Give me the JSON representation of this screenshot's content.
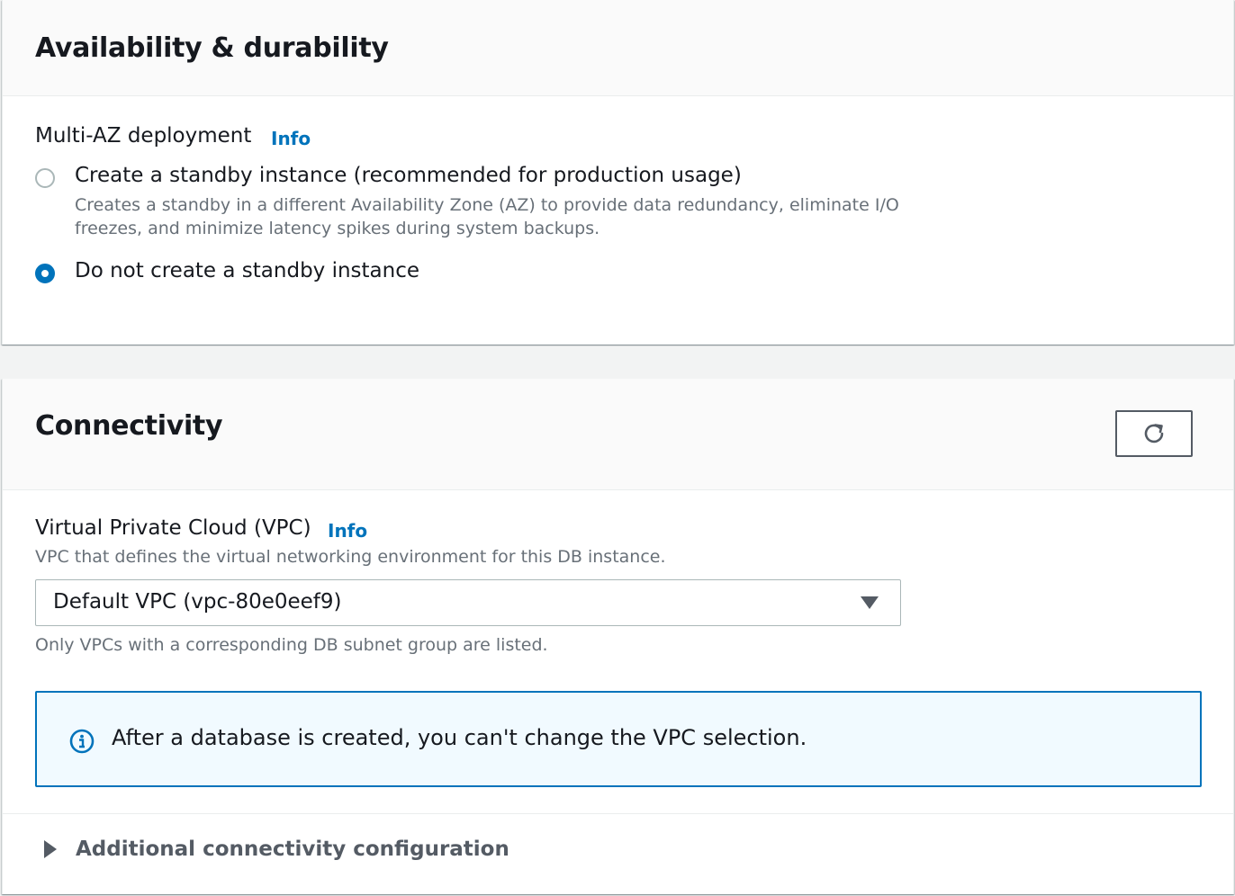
{
  "availability": {
    "title": "Availability & durability",
    "multi_az": {
      "label": "Multi-AZ deployment",
      "info": "Info",
      "options": [
        {
          "label": "Create a standby instance (recommended for production usage)",
          "description": "Creates a standby in a different Availability Zone (AZ) to provide data redundancy, eliminate I/O freezes, and minimize latency spikes during system backups.",
          "selected": false
        },
        {
          "label": "Do not create a standby instance",
          "selected": true
        }
      ]
    }
  },
  "connectivity": {
    "title": "Connectivity",
    "refresh_icon": "refresh-icon",
    "vpc": {
      "label": "Virtual Private Cloud (VPC)",
      "info": "Info",
      "description": "VPC that defines the virtual networking environment for this DB instance.",
      "selected_value": "Default VPC (vpc-80e0eef9)",
      "hint": "Only VPCs with a corresponding DB subnet group are listed."
    },
    "alert": {
      "icon": "info-circle-icon",
      "text": "After a database is created, you can't change the VPC selection."
    },
    "additional": {
      "label": "Additional connectivity configuration",
      "expanded": false
    }
  },
  "colors": {
    "accent": "#0073bb",
    "alert_background": "#f1faff",
    "muted_text": "#687078"
  }
}
